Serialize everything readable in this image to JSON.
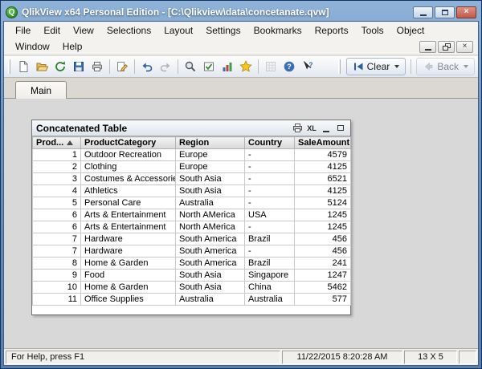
{
  "window": {
    "title": "QlikView x64 Personal Edition - [C:\\Qlikview\\data\\concetanate.qvw]",
    "icon_letter": "Q"
  },
  "menu": {
    "row1": [
      "File",
      "Edit",
      "View",
      "Selections",
      "Layout",
      "Settings",
      "Bookmarks",
      "Reports",
      "Tools",
      "Object"
    ],
    "row2": [
      "Window",
      "Help"
    ]
  },
  "toolbar": {
    "clear_label": "Clear",
    "back_label": "Back",
    "icons": [
      "new",
      "open",
      "reload",
      "save",
      "print",
      "edit-script",
      "undo",
      "redo",
      "search",
      "current-selections",
      "chart-wizard",
      "favorites",
      "design-grid",
      "help",
      "context-help"
    ]
  },
  "tabs": [
    {
      "label": "Main"
    }
  ],
  "table_object": {
    "title": "Concatenated Table",
    "caption_icons": {
      "excel_label": "XL"
    },
    "columns": [
      "Prod...",
      "ProductCategory",
      "Region",
      "Country",
      "SaleAmount"
    ],
    "rows": [
      [
        "1",
        "Outdoor Recreation",
        "Europe",
        "-",
        "4579"
      ],
      [
        "2",
        "Clothing",
        "Europe",
        "-",
        "4125"
      ],
      [
        "3",
        "Costumes & Accessories",
        "South Asia",
        "-",
        "6521"
      ],
      [
        "4",
        "Athletics",
        "South Asia",
        "-",
        "4125"
      ],
      [
        "5",
        "Personal Care",
        "Australia",
        "-",
        "5124"
      ],
      [
        "6",
        "Arts & Entertainment",
        "North AMerica",
        "USA",
        "1245"
      ],
      [
        "6",
        "Arts & Entertainment",
        "North AMerica",
        "-",
        "1245"
      ],
      [
        "7",
        "Hardware",
        "South America",
        "Brazil",
        "456"
      ],
      [
        "7",
        "Hardware",
        "South America",
        "-",
        "456"
      ],
      [
        "8",
        "Home & Garden",
        "South America",
        "Brazil",
        "241"
      ],
      [
        "9",
        "Food",
        "South Asia",
        "Singapore",
        "1247"
      ],
      [
        "10",
        "Home & Garden",
        "South Asia",
        "China",
        "5462"
      ],
      [
        "11",
        "Office Supplies",
        "Australia",
        "Australia",
        "577"
      ]
    ]
  },
  "status_bar": {
    "help_text": "For Help, press F1",
    "timestamp": "11/22/2015 8:20:28 AM",
    "dimensions": "13 X 5"
  },
  "colors": {
    "titlebar_blue": "#6e95c2",
    "qlik_green": "#2f8f2a",
    "content_gray": "#d8d8d8"
  }
}
